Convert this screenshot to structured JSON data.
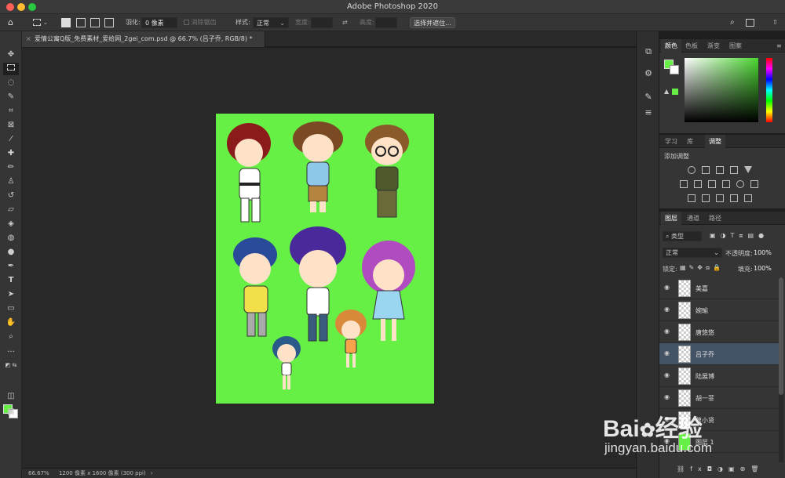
{
  "app": {
    "title": "Adobe Photoshop 2020"
  },
  "options": {
    "feather_label": "羽化:",
    "feather_value": "0 像素",
    "antialias_label": "消除锯齿",
    "style_label": "样式:",
    "style_value": "正常",
    "width_label": "宽度:",
    "height_label": "高度:",
    "select_mask_button": "选择并遮住..."
  },
  "document": {
    "tab_title": "爱情公寓Q版_免费素材_爱给网_2gei_com.psd @ 66.7% (吕子乔, RGB/8) *",
    "zoom": "66.67%",
    "size_info": "1200 像素 x 1600 像素 (300 ppi)",
    "canvas_color": "#66ef45"
  },
  "panels": {
    "color_tabs": [
      "颜色",
      "色板",
      "渐变",
      "图案"
    ],
    "adjust_tabs": [
      "学习",
      "库",
      "调整"
    ],
    "adjust_title": "添加调整",
    "layers_tabs": [
      "图层",
      "通道",
      "路径"
    ],
    "filter_kind": "类型",
    "blend_mode": "正常",
    "opacity_label": "不透明度:",
    "opacity_value": "100%",
    "lock_label": "锁定:",
    "fill_label": "填充:",
    "fill_value": "100%",
    "foreground_color": "#66ef45",
    "background_color": "#ffffff"
  },
  "layers": [
    {
      "name": "美嘉",
      "selected": false
    },
    {
      "name": "婉瑜",
      "selected": false
    },
    {
      "name": "唐悠悠",
      "selected": false
    },
    {
      "name": "吕子乔",
      "selected": true
    },
    {
      "name": "陆展博",
      "selected": false
    },
    {
      "name": "胡一菲",
      "selected": false
    },
    {
      "name": "曾小贤",
      "selected": false
    },
    {
      "name": "图层 1",
      "selected": false
    }
  ],
  "watermark": {
    "brand": "Bai",
    "brand2": "经验",
    "url": "jingyan.baidu.com"
  }
}
